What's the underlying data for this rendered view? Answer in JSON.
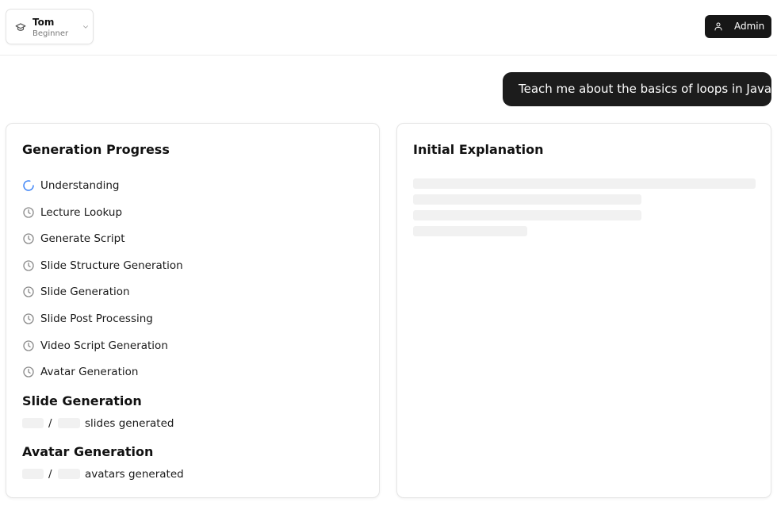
{
  "user": {
    "name": "Tom",
    "level": "Beginner"
  },
  "header": {
    "admin_label": "Admin"
  },
  "chat": {
    "user_message": "Teach me about the basics of loops in Java"
  },
  "progress": {
    "title": "Generation Progress",
    "steps": [
      {
        "label": "Understanding",
        "status": "in-progress"
      },
      {
        "label": "Lecture Lookup",
        "status": "pending"
      },
      {
        "label": "Generate Script",
        "status": "pending"
      },
      {
        "label": "Slide Structure Generation",
        "status": "pending"
      },
      {
        "label": "Slide Generation",
        "status": "pending"
      },
      {
        "label": "Slide Post Processing",
        "status": "pending"
      },
      {
        "label": "Video Script Generation",
        "status": "pending"
      },
      {
        "label": "Avatar Generation",
        "status": "pending"
      }
    ],
    "slide_section": {
      "title": "Slide Generation",
      "separator": "/",
      "suffix": "slides generated"
    },
    "avatar_section": {
      "title": "Avatar Generation",
      "separator": "/",
      "suffix": "avatars generated"
    }
  },
  "explanation": {
    "title": "Initial Explanation"
  },
  "icons": {
    "user_switcher": "graduation-cap-icon",
    "dropdown": "chevron-down-icon",
    "admin": "user-icon",
    "step_in_progress": "spinner-icon",
    "step_pending": "clock-icon"
  },
  "colors": {
    "accent": "#3b82f6",
    "dark": "#171717",
    "skeleton": "#f1f1f1"
  }
}
